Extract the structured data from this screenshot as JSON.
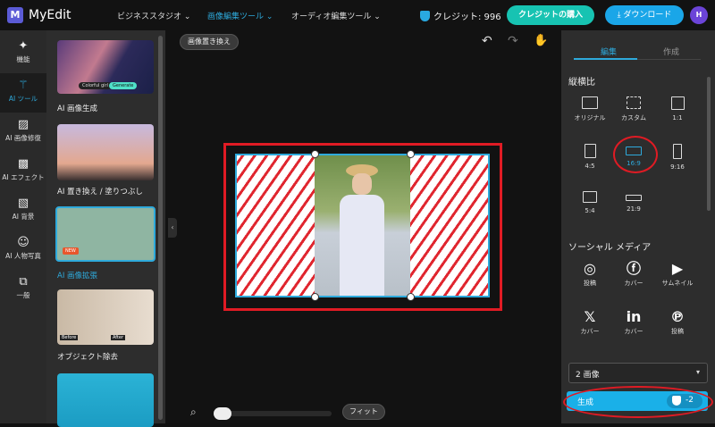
{
  "app": {
    "name": "MyEdit",
    "logo_letter": "M"
  },
  "nav": [
    {
      "label": "ビジネススタジオ ⌄"
    },
    {
      "label": "画像編集ツール ⌄"
    },
    {
      "label": "オーディオ編集ツール ⌄"
    }
  ],
  "credits": {
    "label": "クレジット: 996"
  },
  "buy_credits": "クレジットの購入",
  "download": "ダウンロード",
  "avatar": "H",
  "rail": [
    {
      "label": "機能",
      "icon": "sparkle"
    },
    {
      "label": "AI ツール",
      "icon": "magic-wand"
    },
    {
      "label": "AI 画像修復",
      "icon": "image-fix"
    },
    {
      "label": "AI エフェクト",
      "icon": "effect"
    },
    {
      "label": "AI 背景",
      "icon": "background"
    },
    {
      "label": "AI 人物写真",
      "icon": "portrait"
    },
    {
      "label": "一般",
      "icon": "copy"
    }
  ],
  "thumbs": [
    {
      "label": "AI 画像生成",
      "chip1": "Colorful girl",
      "chip2": "Generate"
    },
    {
      "label": "AI 置き換え / 塗りつぶし"
    },
    {
      "label": "AI 画像拡張",
      "badge": "NEW"
    },
    {
      "label": "オブジェクト除去",
      "before": "Before",
      "after": "After"
    }
  ],
  "canvas": {
    "replace_label": "画像置き換え",
    "fit_label": "フィット",
    "zoom_percent": 5
  },
  "right": {
    "tabs": [
      "編集",
      "作成"
    ],
    "aspect_title": "縦横比",
    "aspects": [
      {
        "label": "オリジナル"
      },
      {
        "label": "カスタム"
      },
      {
        "label": "1:1"
      },
      {
        "label": "4:5"
      },
      {
        "label": "16:9",
        "selected": true
      },
      {
        "label": "9:16"
      },
      {
        "label": "5:4"
      },
      {
        "label": "21:9"
      }
    ],
    "social_title": "ソーシャル メディア",
    "social": [
      {
        "icon": "instagram",
        "label": "投稿"
      },
      {
        "icon": "facebook",
        "label": "カバー"
      },
      {
        "icon": "youtube",
        "label": "サムネイル"
      },
      {
        "icon": "x",
        "label": "カバー"
      },
      {
        "icon": "linkedin",
        "label": "カバー"
      },
      {
        "icon": "pinterest",
        "label": "投稿"
      }
    ],
    "count_select": "2 画像",
    "generate": "生成",
    "cost": "-2"
  },
  "colors": {
    "accent": "#2eaadc",
    "highlight": "#e01b24"
  }
}
